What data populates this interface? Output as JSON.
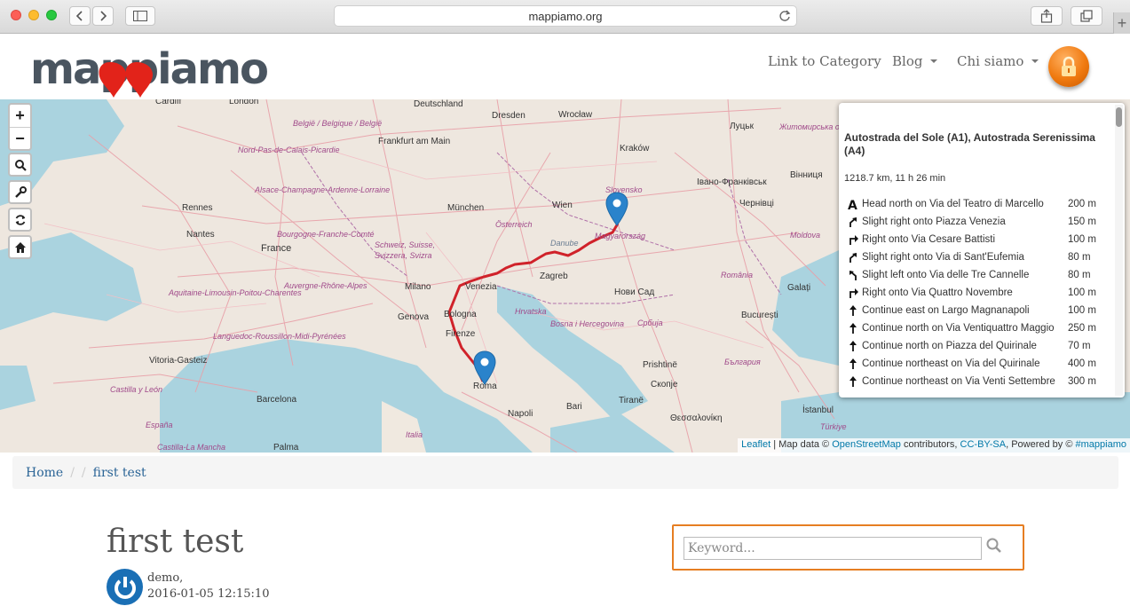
{
  "browser": {
    "url": "mappiamo.org"
  },
  "header": {
    "logo_text": "mappiamo",
    "nav": [
      {
        "label": "Link to Category",
        "dropdown": false
      },
      {
        "label": "Blog",
        "dropdown": true
      },
      {
        "label": "Chi siamo",
        "dropdown": true
      }
    ],
    "accent_color": "#e67e22"
  },
  "map": {
    "attribution": {
      "leaflet": "Leaflet",
      "text1": " | Map data © ",
      "osm": "OpenStreetMap",
      "text2": " contributors, ",
      "license": "CC-BY-SA",
      "text3": ", Powered by © ",
      "powered": "#mappiamo"
    },
    "labels": [
      "Cardiff",
      "London",
      "Deutschland",
      "België / Belgique / België",
      "Frankfurt am Main",
      "Dresden",
      "Wrocław",
      "Kraków",
      "Луцьк",
      "Житомирська область",
      "Вінниця",
      "Івано-Франківськ",
      "Чернівці",
      "Nord-Pas-de-Calais-Picardie",
      "Alsace-Champagne-Ardenne-Lorraine",
      "Rennes",
      "Nantes",
      "Bourgogne-Franche-Comté",
      "France",
      "München",
      "Wien",
      "Slovensko",
      "Magyarország",
      "Österreich",
      "Schweiz, Suisse, Svizzera, Svizra",
      "Moldova",
      "Aquitaine-Limousin-Poitou-Charentes",
      "Auvergne-Rhône-Alpes",
      "Milano",
      "Venezia",
      "Zagreb",
      "Hrvatska",
      "Нови Сад",
      "Galați",
      "România",
      "București",
      "Genova",
      "Bologna",
      "Bosna i Hercegovina",
      "Србија",
      "Languedoc-Roussillon-Midi-Pyrénées",
      "Firenze",
      "Vitoria-Gasteiz",
      "Castilla y León",
      "Roma",
      "Prishtinë",
      "Скопје",
      "България",
      "Barcelona",
      "Napoli",
      "Bari",
      "Tiranë",
      "Θεσσαλονίκη",
      "İstanbul",
      "Türkiye",
      "Italia",
      "España",
      "Castilla-La Mancha",
      "Palma",
      "Danube"
    ]
  },
  "route": {
    "title": "Autostrada del Sole (A1), Autostrada Serenissima (A4)",
    "summary": "1218.7 km, 11 h 26 min",
    "instructions": [
      {
        "icon": "depart-icon",
        "text": "Head north on Via del Teatro di Marcello",
        "distance": "200 m"
      },
      {
        "icon": "slight-right-icon",
        "text": "Slight right onto Piazza Venezia",
        "distance": "150 m"
      },
      {
        "icon": "turn-right-icon",
        "text": "Right onto Via Cesare Battisti",
        "distance": "100 m"
      },
      {
        "icon": "slight-right-icon",
        "text": "Slight right onto Via di Sant'Eufemia",
        "distance": "80 m"
      },
      {
        "icon": "slight-left-icon",
        "text": "Slight left onto Via delle Tre Cannelle",
        "distance": "80 m"
      },
      {
        "icon": "turn-right-icon",
        "text": "Right onto Via Quattro Novembre",
        "distance": "100 m"
      },
      {
        "icon": "straight-icon",
        "text": "Continue east on Largo Magnanapoli",
        "distance": "100 m"
      },
      {
        "icon": "straight-icon",
        "text": "Continue north on Via Ventiquattro Maggio",
        "distance": "250 m"
      },
      {
        "icon": "straight-icon",
        "text": "Continue north on Piazza del Quirinale",
        "distance": "70 m"
      },
      {
        "icon": "straight-icon",
        "text": "Continue northeast on Via del Quirinale",
        "distance": "400 m"
      },
      {
        "icon": "straight-icon",
        "text": "Continue northeast on Via Venti Settembre",
        "distance": "300 m"
      }
    ]
  },
  "breadcrumb": {
    "home": "Home",
    "sep1": "/",
    "sep2": "/",
    "current": "first test"
  },
  "post": {
    "title": "first test",
    "author": "demo,",
    "date": "2016-01-05 12:15:10"
  },
  "search": {
    "placeholder": "Keyword..."
  }
}
